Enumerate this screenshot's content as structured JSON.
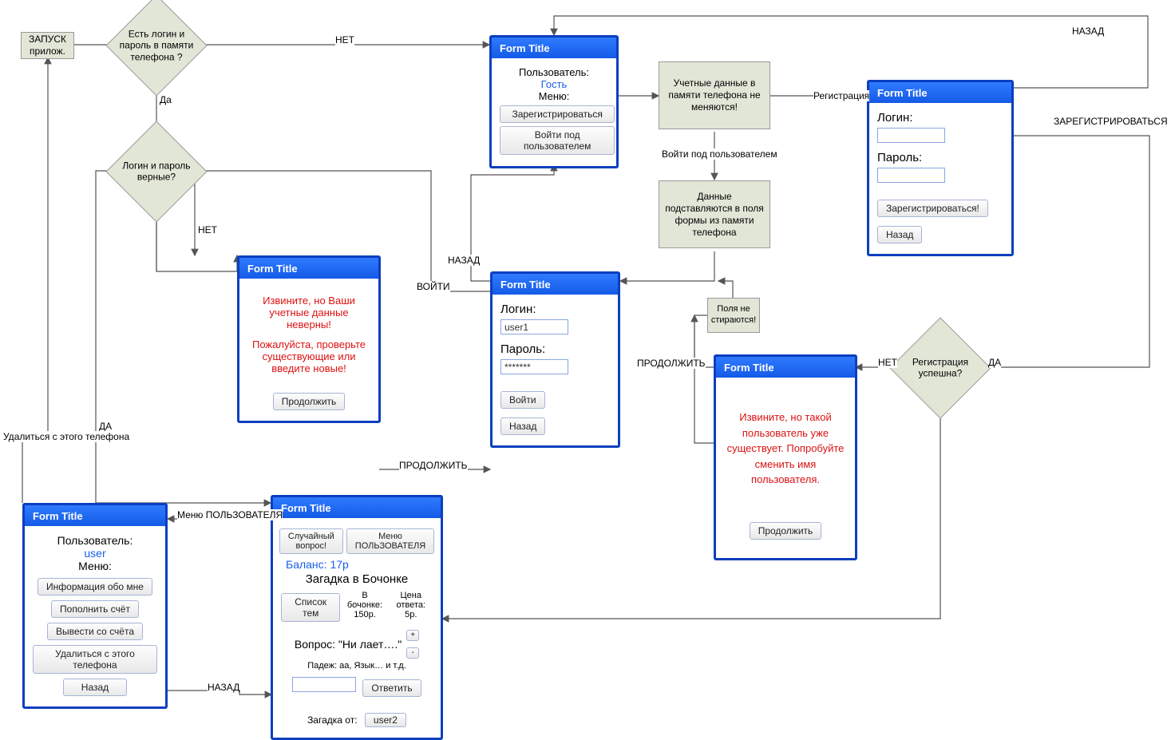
{
  "start": {
    "label": "ЗАПУСК прилож."
  },
  "decisions": {
    "haveCred": "Есть логин и пароль в памяти телефона ?",
    "credOk": "Логин и пароль верные?",
    "regOk": "Регистрация успешна?"
  },
  "procs": {
    "keepCred": "Учетные данные в памяти телефона не меняются!",
    "fillCred": "Данные подставляются в поля формы из памяти телефона",
    "keepFields": "Поля не стираются!"
  },
  "forms": {
    "guest": {
      "title": "Form Title",
      "userLabel": "Пользователь:",
      "userName": "Гость",
      "menuLabel": "Меню:",
      "btnReg": "Зарегистрироваться",
      "btnLogin": "Войти под пользователем"
    },
    "reg": {
      "title": "Form Title",
      "login": "Логин:",
      "pass": "Пароль:",
      "btnReg": "Зарегистрироваться!",
      "btnBack": "Назад"
    },
    "error": {
      "title": "Form Title",
      "l1": "Извините, но Ваши учетные данные неверны!",
      "l2": "Пожалуйста, проверьте существующие или введите новые!",
      "btn": "Продолжить"
    },
    "login": {
      "title": "Form Title",
      "login": "Логин:",
      "loginVal": "user1",
      "pass": "Пароль:",
      "passVal": "*******",
      "btnLogin": "Войти",
      "btnBack": "Назад"
    },
    "regError": {
      "title": "Form Title",
      "l1": "Извините, но такой пользователь уже существует. Попробуйте сменить имя пользователя.",
      "btn": "Продолжить"
    },
    "userMenu": {
      "title": "Form Title",
      "userLabel": "Пользователь:",
      "userName": "user",
      "menuLabel": "Меню:",
      "b1": "Информация обо мне",
      "b2": "Пополнить счёт",
      "b3": "Вывести со счёта",
      "b4": "Удалиться с этого телефона",
      "b5": "Назад"
    },
    "game": {
      "title": "Form Title",
      "btnRand": "Случайный вопрос!",
      "btnMenu": "Меню ПОЛЬЗОВАТЕЛЯ",
      "balance": "Баланс: 17р",
      "riddle": "Загадка в Бочонке",
      "btnTopics": "Список тем",
      "barrelLbl": "В бочонке:",
      "barrelVal": "150р.",
      "priceLbl": "Цена ответа:",
      "priceVal": "5р.",
      "question": "Вопрос: \"Ни лает….\"",
      "hint": "Падеж: аа, Язык… и т.д.",
      "btnAnswer": "Ответить",
      "from": "Загадка от:",
      "fromVal": "user2",
      "plus": "+",
      "minus": "-"
    }
  },
  "edges": {
    "no": "НЕТ",
    "yes": "Да",
    "yesU": "ДА",
    "back": "НАЗАД",
    "reg": "Регистрация",
    "loginUser": "Войти под пользователем",
    "enter": "ВОЙТИ",
    "cont": "ПРОДОЛЖИТЬ",
    "regUp": "ЗАРЕГИСТРИРОВАТЬСЯ",
    "userMenu": "Меню ПОЛЬЗОВАТЕЛЯ",
    "delete": "Удалиться с этого телефона"
  }
}
